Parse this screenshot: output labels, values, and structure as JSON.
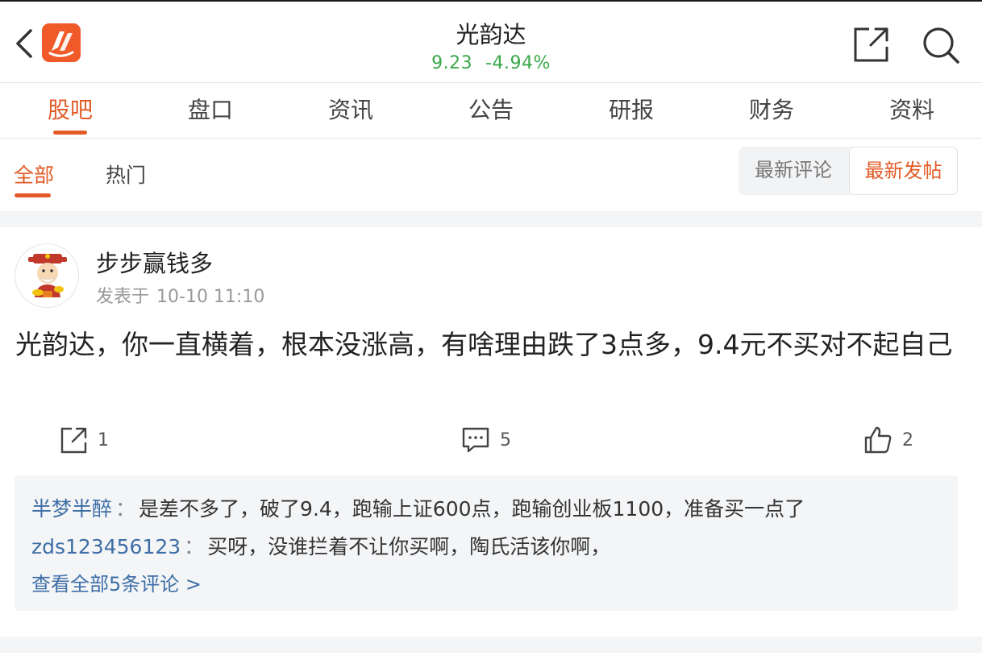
{
  "header": {
    "title": "光韵达",
    "price": "9.23",
    "change_pct": "-4.94%",
    "quote_color": "#3ba84a",
    "brand_color": "#f05a28"
  },
  "tabs": [
    {
      "label": "股吧",
      "active": true
    },
    {
      "label": "盘口",
      "active": false
    },
    {
      "label": "资讯",
      "active": false
    },
    {
      "label": "公告",
      "active": false
    },
    {
      "label": "研报",
      "active": false
    },
    {
      "label": "财务",
      "active": false
    },
    {
      "label": "资料",
      "active": false
    }
  ],
  "subtabs": {
    "all": "全部",
    "hot": "热门",
    "sort_comment": "最新评论",
    "sort_post": "最新发帖"
  },
  "post": {
    "author": "步步赢钱多",
    "posted_prefix": "发表于",
    "posted_time": "10-10 11:10",
    "content": "光韵达，你一直横着，根本没涨高，有啥理由跌了3点多，9.4元不买对不起自己",
    "share_count": "1",
    "comment_count": "5",
    "like_count": "2"
  },
  "comments": [
    {
      "user": "半梦半醉",
      "sep": "：",
      "text": "是差不多了，破了9.4，跑输上证600点，跑输创业板1100，准备买一点了"
    },
    {
      "user": "zds123456123",
      "sep": "：",
      "text": "买呀，没谁拦着不让你买啊，陶氏活该你啊，"
    }
  ],
  "view_all": "查看全部5条评论 >",
  "icons": [
    "back-arrow-icon",
    "app-logo-icon",
    "share-icon",
    "search-icon",
    "comment-icon",
    "thumbs-up-icon"
  ]
}
